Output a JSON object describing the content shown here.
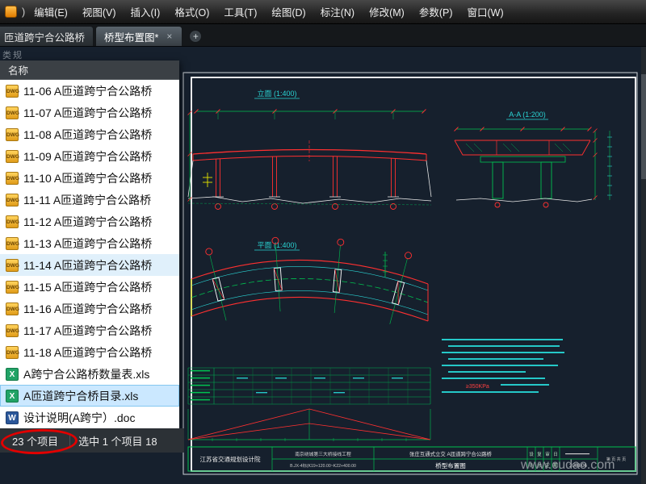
{
  "app": {
    "menu_partial": ")",
    "menu_items": [
      "编辑(E)",
      "视图(V)",
      "插入(I)",
      "格式(O)",
      "工具(T)",
      "绘图(D)",
      "标注(N)",
      "修改(M)",
      "参数(P)",
      "窗口(W)"
    ]
  },
  "tabs": {
    "tab1": "匝道跨宁合公路桥",
    "tab2": "桥型布置图*",
    "close_glyph": "×",
    "add_glyph": "+"
  },
  "side_label": "类规",
  "explorer": {
    "column_header": "名称",
    "files": [
      {
        "name": "11-06 A匝道跨宁合公路桥",
        "type": "dwg"
      },
      {
        "name": "11-07 A匝道跨宁合公路桥",
        "type": "dwg"
      },
      {
        "name": "11-08 A匝道跨宁合公路桥",
        "type": "dwg"
      },
      {
        "name": "11-09 A匝道跨宁合公路桥",
        "type": "dwg"
      },
      {
        "name": "11-10 A匝道跨宁合公路桥",
        "type": "dwg"
      },
      {
        "name": "11-11 A匝道跨宁合公路桥",
        "type": "dwg"
      },
      {
        "name": "11-12 A匝道跨宁合公路桥",
        "type": "dwg"
      },
      {
        "name": "11-13 A匝道跨宁合公路桥",
        "type": "dwg"
      },
      {
        "name": "11-14 A匝道跨宁合公路桥",
        "type": "dwg"
      },
      {
        "name": "11-15 A匝道跨宁合公路桥",
        "type": "dwg"
      },
      {
        "name": "11-16 A匝道跨宁合公路桥",
        "type": "dwg"
      },
      {
        "name": "11-17 A匝道跨宁合公路桥",
        "type": "dwg"
      },
      {
        "name": "11-18 A匝道跨宁合公路桥",
        "type": "dwg"
      },
      {
        "name": "A跨宁合公路桥数量表.xls",
        "type": "xls"
      },
      {
        "name": "A匝道跨宁合桥目录.xls",
        "type": "xls"
      },
      {
        "name": "设计说明(A跨宁）.doc",
        "type": "doc"
      }
    ],
    "icon_labels": {
      "dwg": "DWG",
      "xls": "X",
      "doc": "W"
    },
    "status_count": "23 个项目",
    "status_selection": "选中 1 个项目 18"
  },
  "drawing": {
    "elevation_label": "立面 (1:400)",
    "section_label": "A-A (1:200)",
    "plan_label": "平面 (1:400)",
    "note_kpa": "≥350KPa",
    "titleblock": {
      "org": "江苏省交通规划设计院",
      "project_line1": "南京绕城第三大桥接线工程",
      "project_line2": "B.JX-4标(K19+120.00~K22+400.00",
      "title_line1": "张庄互通式立交  A匝道跨宁合公路桥",
      "title_line2": "桥型布置图",
      "sign_cols": [
        "设",
        "复",
        "审",
        "日",
        "计",
        "核",
        "定",
        "期"
      ],
      "date": "2003.06",
      "sheet": "第 页 共 页"
    },
    "watermark": "www.cudao.com"
  },
  "colors": {
    "accent_red": "#ff3030",
    "accent_green": "#00c050",
    "accent_cyan": "#2ad4d4",
    "accent_yellow": "#e6e600",
    "selection_blue": "#cbe8ff"
  }
}
